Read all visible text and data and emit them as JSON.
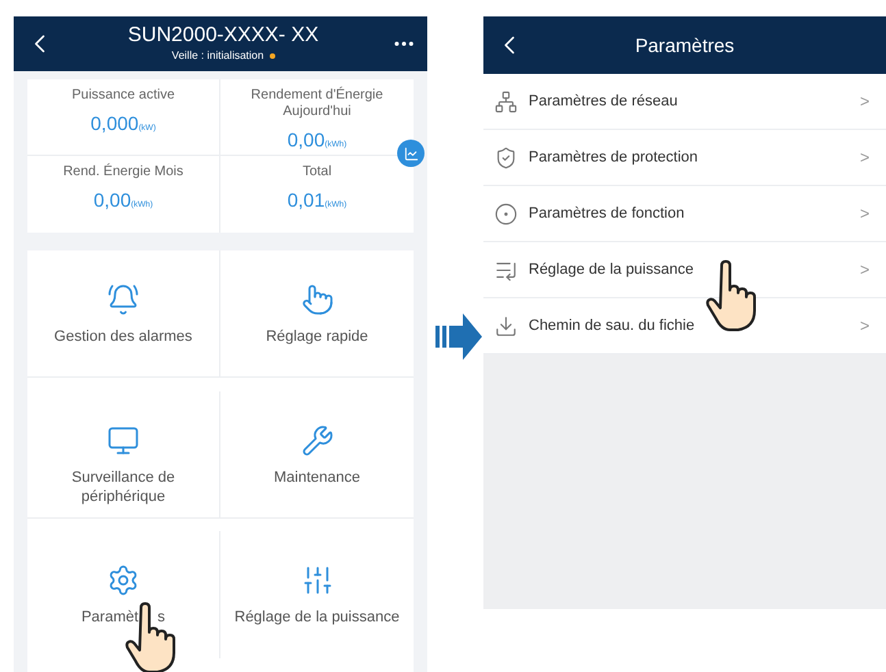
{
  "left_screen": {
    "title": "SUN2000-XXXX- XX",
    "status": "Veille : initialisation",
    "stats": [
      {
        "label": "Puissance active",
        "value": "0,000",
        "unit": "(kW)"
      },
      {
        "label": "Rendement d'Énergie Aujourd'hui",
        "value": "0,00",
        "unit": "(kWh)"
      },
      {
        "label": "Rend. Énergie Mois",
        "value": "0,00",
        "unit": "(kWh)"
      },
      {
        "label": "Total",
        "value": "0,01",
        "unit": "(kWh)"
      }
    ],
    "tiles": [
      {
        "kind": "bell",
        "label_parts": [
          "Gestion des alarmes"
        ]
      },
      {
        "kind": "touch",
        "label_parts": [
          "Réglage rapide"
        ]
      },
      {
        "kind": "monitor",
        "label_parts": [
          "Surveillance de périphérique"
        ]
      },
      {
        "kind": "wrench",
        "label_parts": [
          "Maintenance"
        ]
      },
      {
        "kind": "gear",
        "label_parts": [
          "Paramèt",
          "s"
        ]
      },
      {
        "kind": "sliders",
        "label_parts": [
          "Réglage de la puissance"
        ]
      }
    ]
  },
  "right_screen": {
    "title": "Paramètres",
    "items": [
      {
        "kind": "grid",
        "label": "Paramètres de réseau",
        "chevron": ">"
      },
      {
        "kind": "shield",
        "label": "Paramètres de protection",
        "chevron": ">"
      },
      {
        "kind": "function",
        "label": "Paramètres de fonction",
        "chevron": ">"
      },
      {
        "kind": "power",
        "label": "Réglage de la puissance",
        "chevron": ">"
      },
      {
        "kind": "download",
        "label": "Chemin de sau. du fichie",
        "chevron": ">"
      }
    ]
  }
}
